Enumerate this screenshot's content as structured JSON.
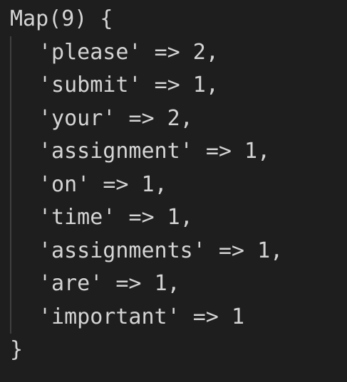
{
  "map": {
    "header": "Map(9) {",
    "arrow": "=>",
    "footer": "}",
    "entries": [
      {
        "key": "'please'",
        "value": "2",
        "separator": ","
      },
      {
        "key": "'submit'",
        "value": "1",
        "separator": ","
      },
      {
        "key": "'your'",
        "value": "2",
        "separator": ","
      },
      {
        "key": "'assignment'",
        "value": "1",
        "separator": ","
      },
      {
        "key": "'on'",
        "value": "1",
        "separator": ","
      },
      {
        "key": "'time'",
        "value": "1",
        "separator": ","
      },
      {
        "key": "'assignments'",
        "value": "1",
        "separator": ","
      },
      {
        "key": "'are'",
        "value": "1",
        "separator": ","
      },
      {
        "key": "'important'",
        "value": "1",
        "separator": ""
      }
    ]
  },
  "theme": {
    "background": "#1e1e1e",
    "text": "#d4d4d4",
    "indent_guide": "#404040"
  }
}
